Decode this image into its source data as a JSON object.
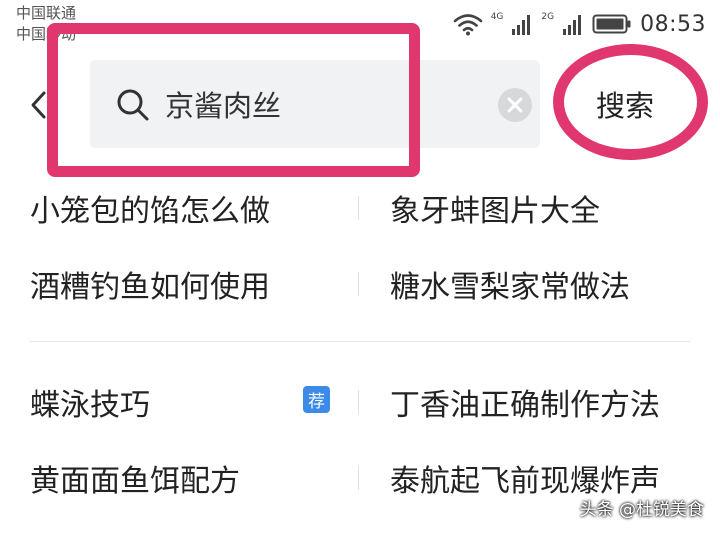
{
  "status_bar": {
    "carrier_1": "中国联通",
    "carrier_2": "中国移动",
    "network_1": "4G",
    "network_2": "2G",
    "time": "08:53"
  },
  "search": {
    "query": "京酱肉丝",
    "button_label": "搜索"
  },
  "suggestions": {
    "group_1": [
      {
        "left": "小笼包的馅怎么做",
        "right": "象牙蚌图片大全"
      },
      {
        "left": "酒糟钓鱼如何使用",
        "right": "糖水雪梨家常做法"
      }
    ],
    "group_2": [
      {
        "left": "蝶泳技巧",
        "badge": "荐",
        "right": "丁香油正确制作方法"
      },
      {
        "left": "黄面面鱼饵配方",
        "right": "泰航起飞前现爆炸声"
      }
    ]
  },
  "annotations": {
    "highlight_color": "#e0376f"
  },
  "watermark": "头条 @杜锐美食"
}
